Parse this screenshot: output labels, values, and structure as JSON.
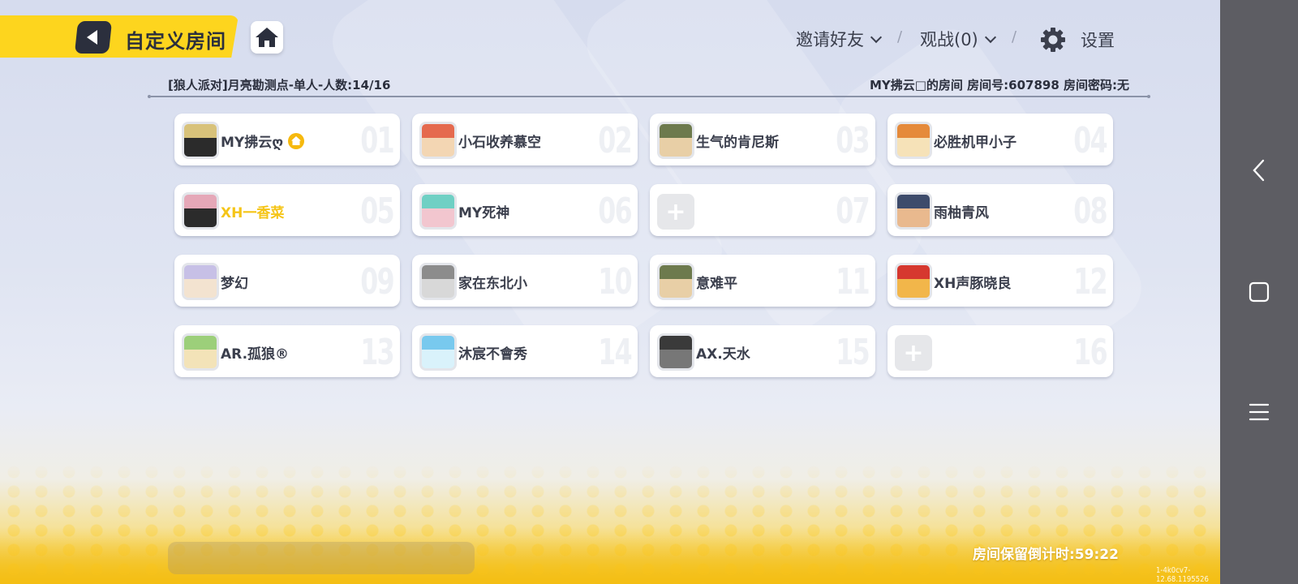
{
  "header": {
    "title": "自定义房间",
    "invite_label": "邀请好友",
    "spectate_label": "观战(0)",
    "settings_label": "设置"
  },
  "room": {
    "mode_info": "[狼人派对]月亮勘测点-单人-人数:14/16",
    "owner_info": "MY拂云□的房间 房间号:607898 房间密码:无"
  },
  "slots": [
    {
      "number": "01",
      "name": "MY拂云ღ",
      "occupied": true,
      "owner": true,
      "avatar_colors": [
        "#d8c27a",
        "#2b2b2b"
      ]
    },
    {
      "number": "02",
      "name": "小石收养慕空",
      "occupied": true,
      "avatar_colors": [
        "#e56a4e",
        "#f3d6b3"
      ]
    },
    {
      "number": "03",
      "name": "生气的肯尼斯",
      "occupied": true,
      "avatar_colors": [
        "#6d7a4d",
        "#e8cfa6"
      ]
    },
    {
      "number": "04",
      "name": "必胜机甲小子",
      "occupied": true,
      "avatar_colors": [
        "#e58a3a",
        "#f6e2b8"
      ]
    },
    {
      "number": "05",
      "name": "XH一香菜",
      "occupied": true,
      "highlight": true,
      "avatar_colors": [
        "#e5a8b8",
        "#2b2b2b"
      ]
    },
    {
      "number": "06",
      "name": "MY死神",
      "occupied": true,
      "avatar_colors": [
        "#6fd0c4",
        "#f2c6cf"
      ]
    },
    {
      "number": "07",
      "name": "",
      "occupied": false
    },
    {
      "number": "08",
      "name": "雨柚青风",
      "occupied": true,
      "avatar_colors": [
        "#3d4b6b",
        "#e9b98e"
      ]
    },
    {
      "number": "09",
      "name": "梦幻",
      "occupied": true,
      "avatar_colors": [
        "#c7c0e6",
        "#f3e3d0"
      ]
    },
    {
      "number": "10",
      "name": "家在东北小",
      "occupied": true,
      "avatar_colors": [
        "#8c8c8c",
        "#d8d8d8"
      ]
    },
    {
      "number": "11",
      "name": "意难平",
      "occupied": true,
      "avatar_colors": [
        "#6d7a4d",
        "#e8cfa6"
      ]
    },
    {
      "number": "12",
      "name": "XH声豚晓良",
      "occupied": true,
      "avatar_colors": [
        "#d6382f",
        "#f2b64a"
      ]
    },
    {
      "number": "13",
      "name": "AR.孤狼®",
      "occupied": true,
      "avatar_colors": [
        "#9ccf7a",
        "#f3e3b8"
      ]
    },
    {
      "number": "14",
      "name": "沐宸不會秀",
      "occupied": true,
      "avatar_colors": [
        "#78c9ee",
        "#d9f2fb"
      ]
    },
    {
      "number": "15",
      "name": "AX.天水",
      "occupied": true,
      "avatar_colors": [
        "#3a3a3a",
        "#777777"
      ]
    },
    {
      "number": "16",
      "name": "",
      "occupied": false
    }
  ],
  "footer": {
    "countdown": "房间保留倒计时:59:22",
    "version": "1-4k0cv7-12.68.1195526"
  },
  "colors": {
    "accent_yellow": "#fdd51e",
    "dark": "#2b2f3d",
    "highlight_name": "#f5c518"
  }
}
